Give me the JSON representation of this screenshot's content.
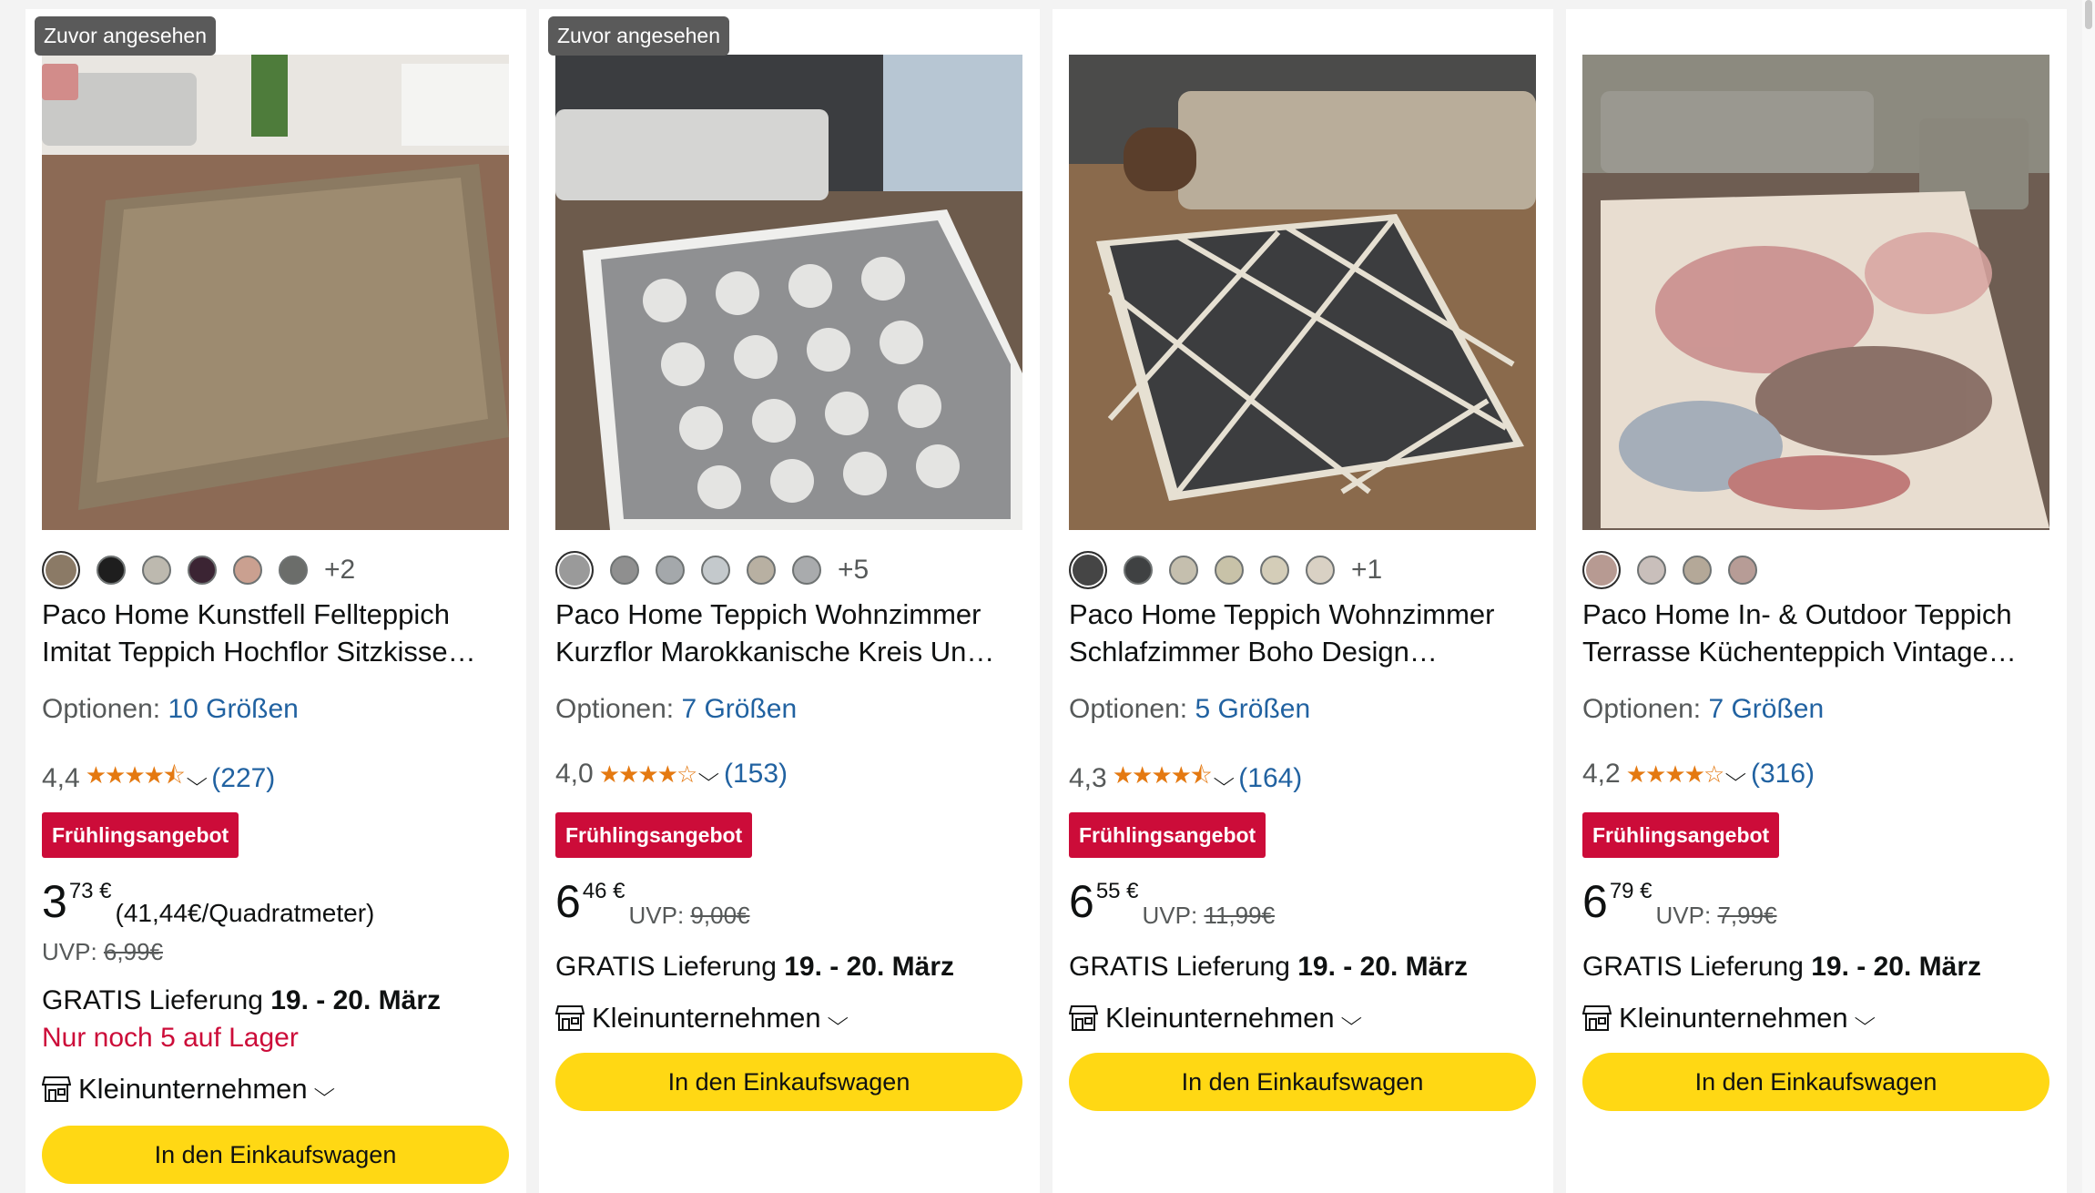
{
  "products": [
    {
      "badge": "Zuvor angesehen",
      "swatches": [
        "#8b7a66",
        "#1e1e1e",
        "#bdb9af",
        "#3b2433",
        "#caa090",
        "#6b6d6a"
      ],
      "swatches_more": "+2",
      "title_line1": "Paco Home Kunstfell Fellteppich",
      "title_line2": "Imitat Teppich Hochflor Sitzkisse…",
      "options_label": "Optionen:",
      "options_link": "10 Größen",
      "rating_value": "4,4",
      "stars": "★★★★⯪",
      "rating_count": "(227)",
      "deal_label": "Frühlingsangebot",
      "price_whole": "3",
      "price_fraction": "73 €",
      "unit_price": "(41,44€/Quadratmeter)",
      "uvp_label": "UVP:",
      "uvp_price": "6,99€",
      "delivery_prefix": "GRATIS Lieferung",
      "delivery_date": "19. - 20. März",
      "stock_text": "Nur noch 5 auf Lager",
      "seller_label": "Kleinunternehmen",
      "cart_label": "In den Einkaufswagen"
    },
    {
      "badge": "Zuvor angesehen",
      "swatches": [
        "#9a9a9a",
        "#8f8f8f",
        "#a4a8ab",
        "#c4c9cc",
        "#b8b0a2",
        "#a9abad"
      ],
      "swatches_more": "+5",
      "title_line1": "Paco Home Teppich Wohnzimmer",
      "title_line2": "Kurzflor Marokkanische Kreis Un…",
      "options_label": "Optionen:",
      "options_link": "7 Größen",
      "rating_value": "4,0",
      "stars": "★★★★☆",
      "rating_count": "(153)",
      "deal_label": "Frühlingsangebot",
      "price_whole": "6",
      "price_fraction": "46 €",
      "uvp_label": "UVP:",
      "uvp_price": "9,00€",
      "delivery_prefix": "GRATIS Lieferung",
      "delivery_date": "19. - 20. März",
      "seller_label": "Kleinunternehmen",
      "cart_label": "In den Einkaufswagen"
    },
    {
      "badge": "",
      "swatches": [
        "#454545",
        "#3f4142",
        "#c5bfae",
        "#c8c2a8",
        "#d4cdb8",
        "#d9d1c4"
      ],
      "swatches_more": "+1",
      "title_line1": "Paco Home Teppich Wohnzimmer",
      "title_line2": "Schlafzimmer Boho Design…",
      "options_label": "Optionen:",
      "options_link": "5 Größen",
      "rating_value": "4,3",
      "stars": "★★★★⯪",
      "rating_count": "(164)",
      "deal_label": "Frühlingsangebot",
      "price_whole": "6",
      "price_fraction": "55 €",
      "uvp_label": "UVP:",
      "uvp_price": "11,99€",
      "delivery_prefix": "GRATIS Lieferung",
      "delivery_date": "19. - 20. März",
      "seller_label": "Kleinunternehmen",
      "cart_label": "In den Einkaufswagen"
    },
    {
      "badge": "",
      "swatches": [
        "#b79a92",
        "#c9bfbb",
        "#b4a898",
        "#b79c96"
      ],
      "swatches_more": "",
      "title_line1": "Paco Home In- & Outdoor Teppich",
      "title_line2": "Terrasse Küchenteppich Vintage…",
      "options_label": "Optionen:",
      "options_link": "7 Größen",
      "rating_value": "4,2",
      "stars": "★★★★☆",
      "rating_count": "(316)",
      "deal_label": "Frühlingsangebot",
      "price_whole": "6",
      "price_fraction": "79 €",
      "uvp_label": "UVP:",
      "uvp_price": "7,99€",
      "delivery_prefix": "GRATIS Lieferung",
      "delivery_date": "19. - 20. März",
      "seller_label": "Kleinunternehmen",
      "cart_label": "In den Einkaufswagen"
    }
  ]
}
